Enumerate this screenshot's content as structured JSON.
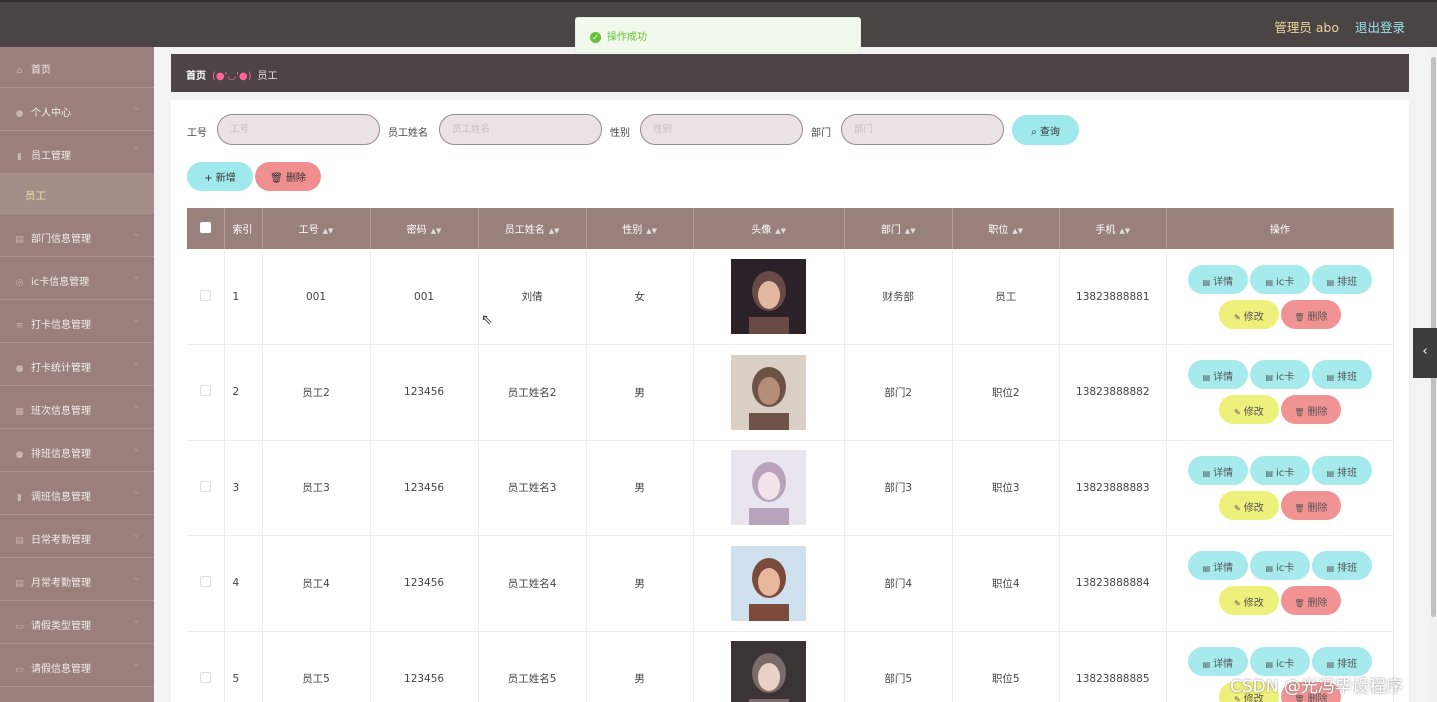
{
  "topbar": {
    "admin_label": "管理员 abo",
    "logout_label": "退出登录"
  },
  "toast": {
    "message": "操作成功"
  },
  "sidebar": {
    "items": [
      {
        "label": "首页",
        "icon": "home-icon"
      },
      {
        "label": "个人中心",
        "icon": "user-icon"
      },
      {
        "label": "员工管理",
        "icon": "chart-icon"
      },
      {
        "label": "部门信息管理",
        "icon": "doc-icon"
      },
      {
        "label": "ic卡信息管理",
        "icon": "card-icon"
      },
      {
        "label": "打卡信息管理",
        "icon": "list-icon"
      },
      {
        "label": "打卡统计管理",
        "icon": "stats-icon"
      },
      {
        "label": "班次信息管理",
        "icon": "calendar-icon"
      },
      {
        "label": "排班信息管理",
        "icon": "user-icon"
      },
      {
        "label": "调班信息管理",
        "icon": "chart-icon"
      },
      {
        "label": "日常考勤管理",
        "icon": "doc-icon"
      },
      {
        "label": "月常考勤管理",
        "icon": "doc-icon"
      },
      {
        "label": "请假类型管理",
        "icon": "chat-icon"
      },
      {
        "label": "请假信息管理",
        "icon": "chat-icon"
      }
    ],
    "submenu_label": "员工"
  },
  "breadcrumb": {
    "home": "首页",
    "separator": "(●'◡'●)",
    "current": "员工"
  },
  "search": {
    "fields": [
      {
        "label": "工号",
        "placeholder": "工号"
      },
      {
        "label": "员工姓名",
        "placeholder": "员工姓名"
      },
      {
        "label": "性别",
        "placeholder": "性别"
      },
      {
        "label": "部门",
        "placeholder": "部门"
      }
    ],
    "query_label": "查询"
  },
  "actions": {
    "add_label": "新增",
    "delete_label": "删除"
  },
  "table": {
    "headers": {
      "index": "索引",
      "emp_no": "工号",
      "password": "密码",
      "name": "员工姓名",
      "gender": "性别",
      "avatar": "头像",
      "dept": "部门",
      "position": "职位",
      "phone": "手机",
      "ops": "操作"
    },
    "rows": [
      {
        "index": "1",
        "emp_no": "001",
        "password": "001",
        "name": "刘倩",
        "gender": "女",
        "dept": "财务部",
        "position": "员工",
        "phone": "13823888881"
      },
      {
        "index": "2",
        "emp_no": "员工2",
        "password": "123456",
        "name": "员工姓名2",
        "gender": "男",
        "dept": "部门2",
        "position": "职位2",
        "phone": "13823888882"
      },
      {
        "index": "3",
        "emp_no": "员工3",
        "password": "123456",
        "name": "员工姓名3",
        "gender": "男",
        "dept": "部门3",
        "position": "职位3",
        "phone": "13823888883"
      },
      {
        "index": "4",
        "emp_no": "员工4",
        "password": "123456",
        "name": "员工姓名4",
        "gender": "男",
        "dept": "部门4",
        "position": "职位4",
        "phone": "13823888884"
      },
      {
        "index": "5",
        "emp_no": "员工5",
        "password": "123456",
        "name": "员工姓名5",
        "gender": "男",
        "dept": "部门5",
        "position": "职位5",
        "phone": "13823888885"
      }
    ],
    "row_ops": {
      "detail": "详情",
      "iccard": "ic卡",
      "schedule": "排班",
      "edit": "修改",
      "delete": "删除"
    }
  },
  "watermark": "CSDN @光冯毕设程序"
}
